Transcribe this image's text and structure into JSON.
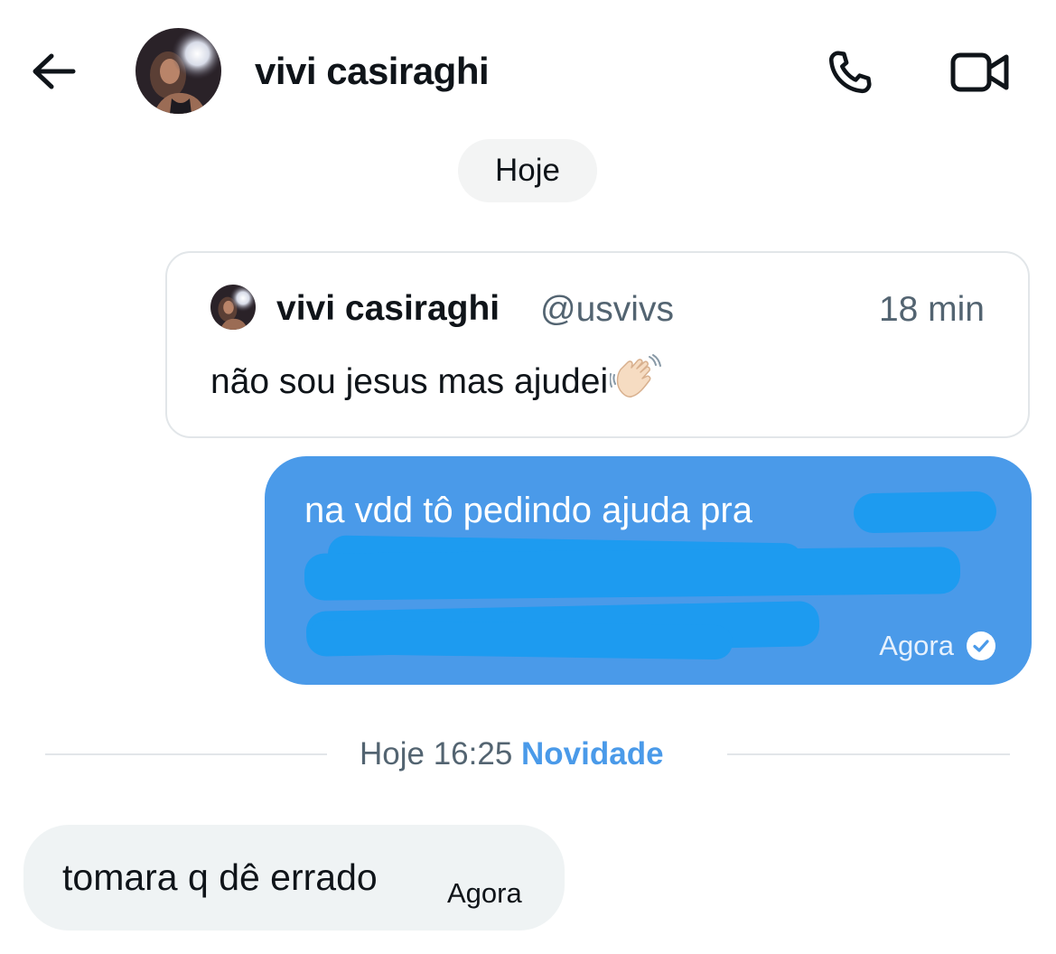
{
  "header": {
    "contact_name": "vivi casiraghi",
    "icons": {
      "back": "arrow-left-icon",
      "call": "phone-icon",
      "video": "video-camera-icon"
    }
  },
  "conversation": {
    "day_label": "Hoje",
    "quoted_tweet": {
      "author_name": "vivi casiraghi",
      "author_handle": "@usvivs",
      "time": "18 min",
      "text": "não sou jesus mas ajudei",
      "emoji": "waving-hand"
    },
    "sent_message": {
      "visible_text": "na vdd tô pedindo ajuda pra",
      "redacted": true,
      "time": "Agora",
      "status_icon": "check-circle-icon"
    },
    "divider": {
      "label": "Hoje 16:25",
      "badge": "Novidade"
    },
    "received_message": {
      "text": "tomara q dê errado",
      "time": "Agora"
    }
  },
  "colors": {
    "sent_bubble": "#4a9ae9",
    "redaction": "#1d9bf0",
    "received_bubble": "#eff3f4",
    "accent": "#4a9ae9",
    "secondary_text": "#536471"
  }
}
